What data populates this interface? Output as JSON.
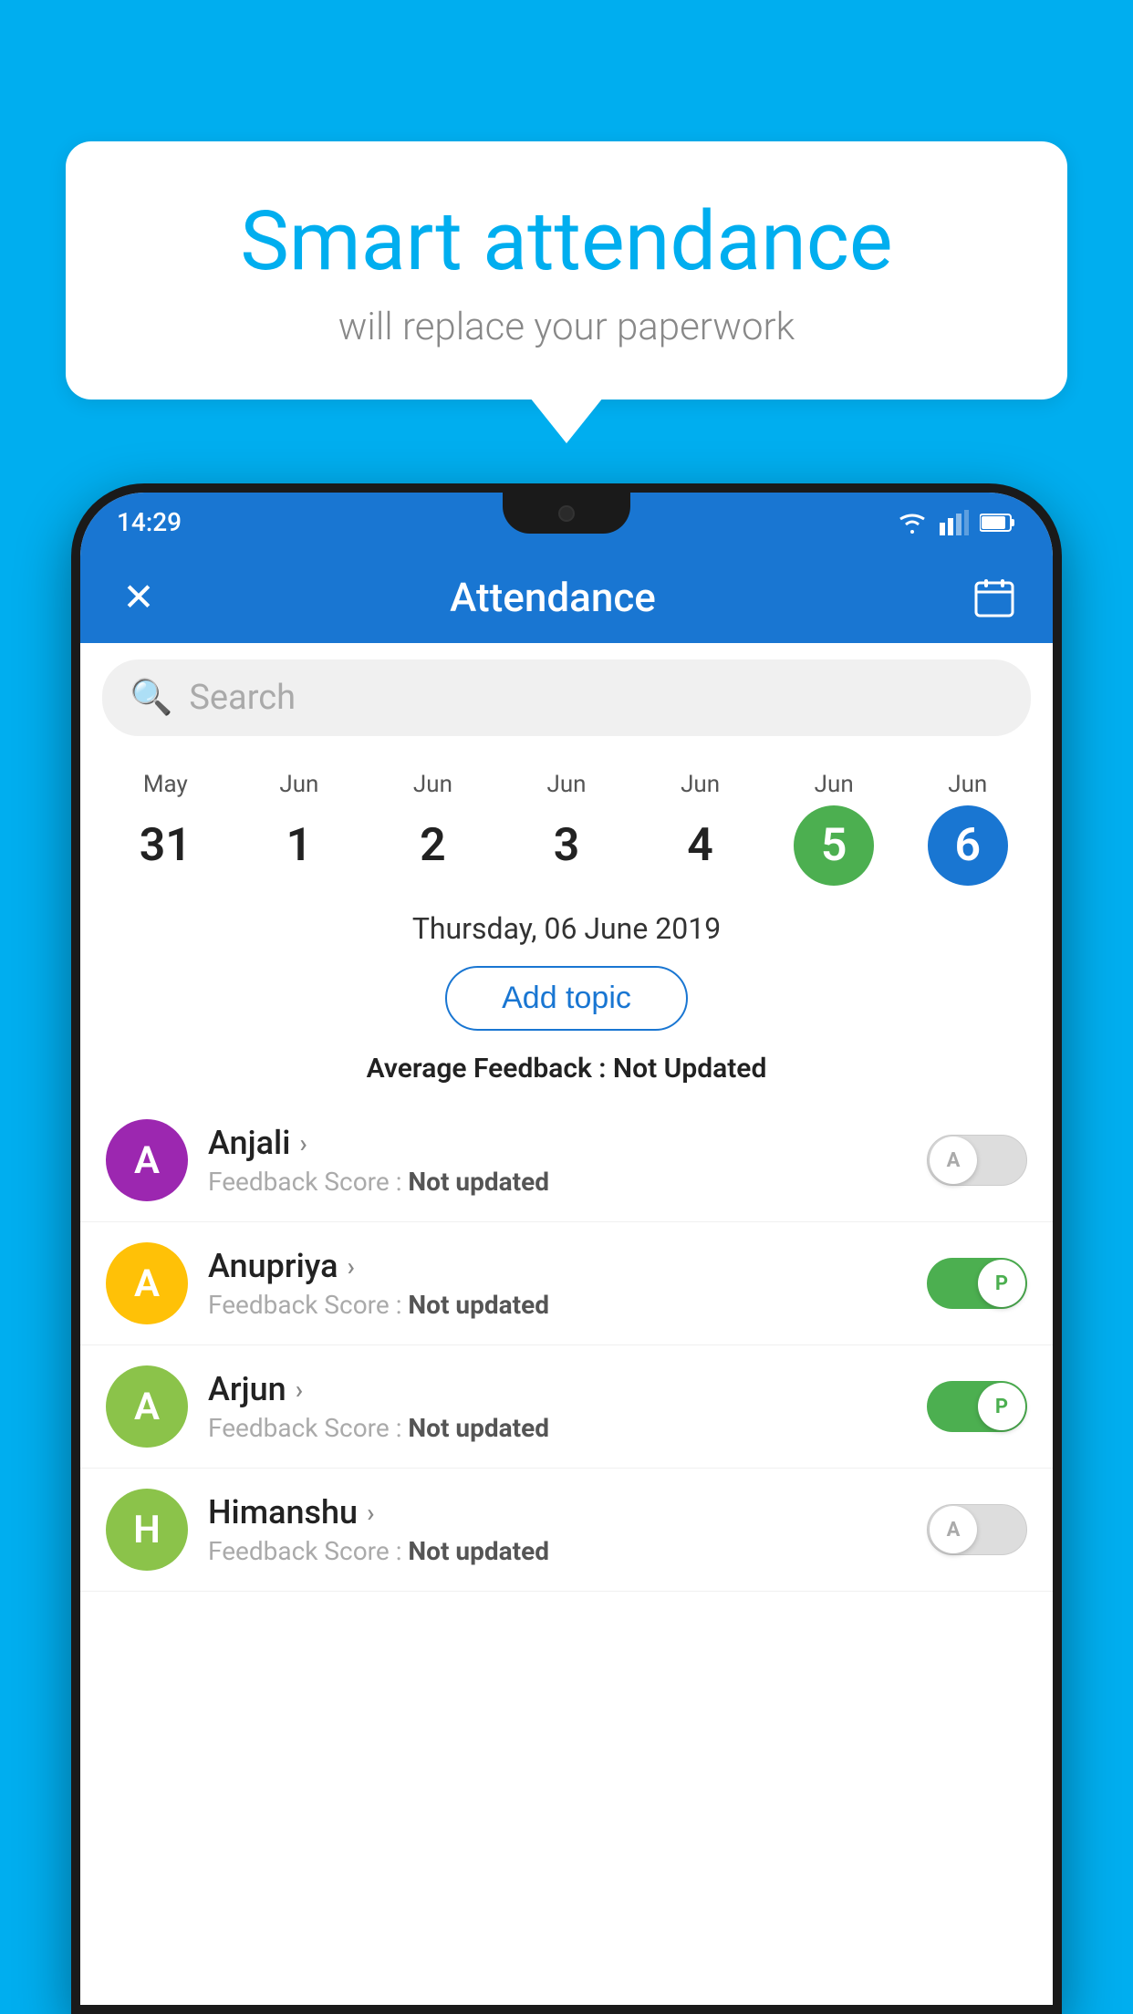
{
  "background": {
    "color": "#00AEEF"
  },
  "bubble": {
    "title": "Smart attendance",
    "subtitle": "will replace your paperwork"
  },
  "status_bar": {
    "time": "14:29"
  },
  "app_bar": {
    "title": "Attendance",
    "close_label": "✕",
    "calendar_label": "📅"
  },
  "search": {
    "placeholder": "Search"
  },
  "dates": [
    {
      "month": "May",
      "day": "31",
      "type": "normal"
    },
    {
      "month": "Jun",
      "day": "1",
      "type": "normal"
    },
    {
      "month": "Jun",
      "day": "2",
      "type": "normal"
    },
    {
      "month": "Jun",
      "day": "3",
      "type": "normal"
    },
    {
      "month": "Jun",
      "day": "4",
      "type": "normal"
    },
    {
      "month": "Jun",
      "day": "5",
      "type": "today"
    },
    {
      "month": "Jun",
      "day": "6",
      "type": "selected"
    }
  ],
  "selected_date": "Thursday, 06 June 2019",
  "add_topic_label": "Add topic",
  "avg_feedback_label": "Average Feedback : ",
  "avg_feedback_value": "Not Updated",
  "students": [
    {
      "name": "Anjali",
      "feedback": "Not updated",
      "avatar_letter": "A",
      "avatar_color": "#9C27B0",
      "toggle_state": "off",
      "toggle_label": "A"
    },
    {
      "name": "Anupriya",
      "feedback": "Not updated",
      "avatar_letter": "A",
      "avatar_color": "#FFC107",
      "toggle_state": "on",
      "toggle_label": "P"
    },
    {
      "name": "Arjun",
      "feedback": "Not updated",
      "avatar_letter": "A",
      "avatar_color": "#8BC34A",
      "toggle_state": "on",
      "toggle_label": "P"
    },
    {
      "name": "Himanshu",
      "feedback": "Not updated",
      "avatar_letter": "H",
      "avatar_color": "#8BC34A",
      "toggle_state": "off",
      "toggle_label": "A"
    }
  ]
}
